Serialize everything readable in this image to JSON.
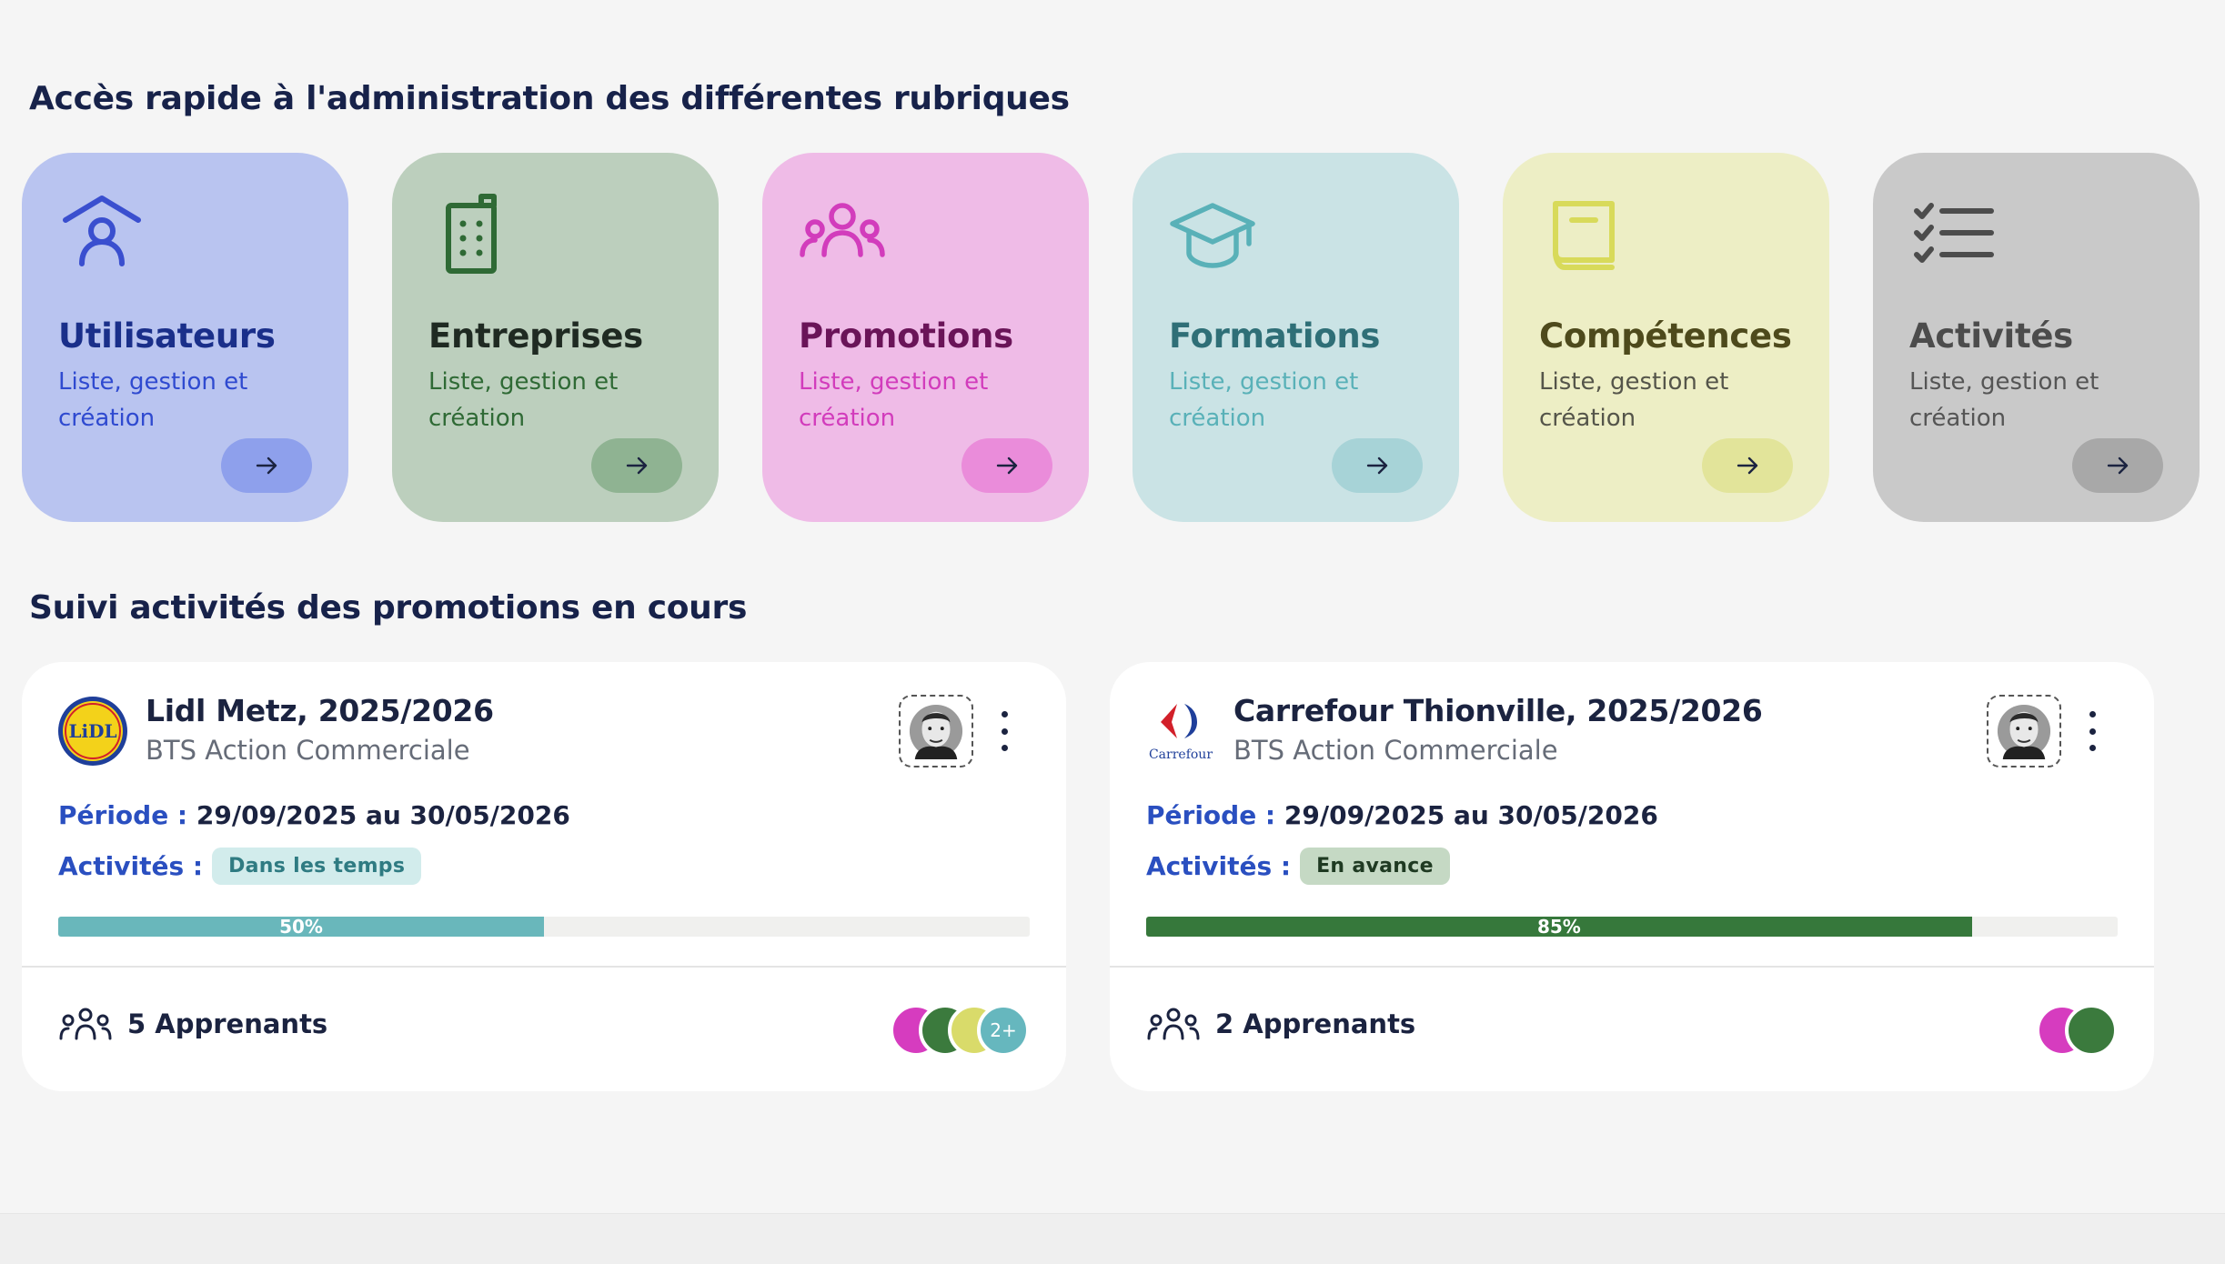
{
  "quick_access": {
    "title": "Accès rapide à l'administration des différentes rubriques",
    "tiles": [
      {
        "title": "Utilisateurs",
        "subtitle": "Liste, gestion et création",
        "icon": "user-home-icon",
        "bg": "#b9c4f0",
        "title_color": "#1a2f8a",
        "sub_color": "#2f4ad0",
        "btn_bg": "#8ea0ec",
        "icon_color": "#3a4fcf"
      },
      {
        "title": "Entreprises",
        "subtitle": "Liste, gestion et création",
        "icon": "building-icon",
        "bg": "#bccfbd",
        "title_color": "#1f2a22",
        "sub_color": "#2f6a35",
        "btn_bg": "#8fb392",
        "icon_color": "#2f6a35"
      },
      {
        "title": "Promotions",
        "subtitle": "Liste, gestion et création",
        "icon": "group-icon",
        "bg": "#efbbe7",
        "title_color": "#6a1458",
        "sub_color": "#d23cbc",
        "btn_bg": "#ea8cda",
        "icon_color": "#d23cbc"
      },
      {
        "title": "Formations",
        "subtitle": "Liste, gestion et création",
        "icon": "graduation-cap-icon",
        "bg": "#cae3e5",
        "title_color": "#2f6f77",
        "sub_color": "#59b1b8",
        "btn_bg": "#a7d3d7",
        "icon_color": "#59b1b8"
      },
      {
        "title": "Compétences",
        "subtitle": "Liste, gestion et création",
        "icon": "book-icon",
        "bg": "#edeec5",
        "title_color": "#4e4a1c",
        "sub_color": "#55554a",
        "btn_bg": "#e2e49a",
        "icon_color": "#d8da5a"
      },
      {
        "title": "Activités",
        "subtitle": "Liste, gestion et création",
        "icon": "checklist-icon",
        "bg": "#c9c9c9",
        "title_color": "#4c4c4c",
        "sub_color": "#555555",
        "btn_bg": "#a8a8a8",
        "icon_color": "#4c4c4c"
      }
    ]
  },
  "tracking": {
    "title": "Suivi activités des promotions en cours",
    "period_label": "Période :",
    "activities_label": "Activités :",
    "cards": [
      {
        "logo": "lidl-logo",
        "title": "Lidl Metz, 2025/2026",
        "subtitle": "BTS Action Commerciale",
        "period": "29/09/2025 au 30/05/2026",
        "status": "Dans les temps",
        "status_bg": "#d2ecec",
        "status_color": "#2f7b82",
        "progress": 50,
        "progress_label": "50%",
        "progress_color": "#69b7bb",
        "learners": "5 Apprenants",
        "avatars": [
          "#d63cbf",
          "#3b7a3d",
          "#d9db6a",
          "#66b7be"
        ],
        "more": "2+"
      },
      {
        "logo": "carrefour-logo",
        "title": "Carrefour Thionville, 2025/2026",
        "subtitle": "BTS Action Commerciale",
        "period": "29/09/2025 au 30/05/2026",
        "status": "En avance",
        "status_bg": "#c5d9c4",
        "status_color": "#1f3a22",
        "progress": 85,
        "progress_label": "85%",
        "progress_color": "#36783b",
        "learners": "2 Apprenants",
        "avatars": [
          "#d63cbf",
          "#3b7a3d"
        ],
        "more": ""
      }
    ]
  },
  "logos": {
    "lidl_text": "LiDL",
    "carrefour_text": "Carrefour"
  }
}
